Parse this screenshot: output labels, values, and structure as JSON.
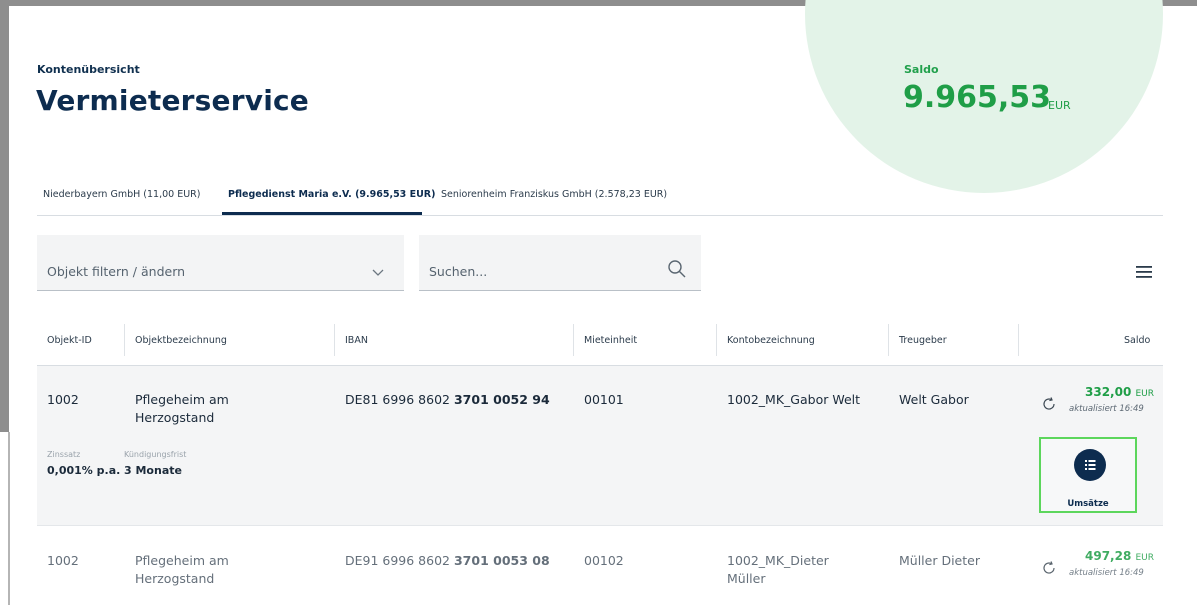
{
  "header": {
    "overline": "Kontenübersicht",
    "title": "Vermieterservice",
    "saldo_label": "Saldo",
    "saldo_value": "9.965,53",
    "saldo_unit": "EUR"
  },
  "tabs": [
    {
      "label": "Niederbayern GmbH (11,00 EUR)",
      "active": false
    },
    {
      "label": "Pflegedienst Maria e.V. (9.965,53 EUR)",
      "active": true
    },
    {
      "label": "Seniorenheim Franziskus GmbH (2.578,23 EUR)",
      "active": false
    }
  ],
  "filters": {
    "object_filter_label": "Objekt filtern / ändern",
    "search_placeholder": "Suchen..."
  },
  "table": {
    "columns": [
      "Objekt-ID",
      "Objektbezeichnung",
      "IBAN",
      "Mieteinheit",
      "Kontobezeichnung",
      "Treugeber",
      "Saldo"
    ],
    "rows": [
      {
        "objekt_id": "1002",
        "bezeichnung_line1": "Pflegeheim am",
        "bezeichnung_line2": "Herzogstand",
        "iban_prefix": "DE81 6996 8602 ",
        "iban_suffix": "3701 0052 94",
        "mieteinheit": "00101",
        "konto_line1": "1002_MK_Gabor Welt",
        "konto_line2": "",
        "treugeber": "Welt Gabor",
        "saldo_amount": "332,00",
        "saldo_unit": "EUR",
        "updated": "aktualisiert 16:49",
        "details": {
          "zinssatz_label": "Zinssatz",
          "zinssatz_value": "0,001% p.a.",
          "kuendigung_label": "Kündigungsfrist",
          "kuendigung_value": "3 Monate"
        },
        "action_label": "Umsätze"
      },
      {
        "objekt_id": "1002",
        "bezeichnung_line1": "Pflegeheim am",
        "bezeichnung_line2": "Herzogstand",
        "iban_prefix": "DE91 6996 8602 ",
        "iban_suffix": "3701 0053 08",
        "mieteinheit": "00102",
        "konto_line1": "1002_MK_Dieter",
        "konto_line2": "Müller",
        "treugeber": "Müller Dieter",
        "saldo_amount": "497,28",
        "saldo_unit": "EUR",
        "updated": "aktualisiert 16:49"
      }
    ]
  },
  "colors": {
    "navy": "#0d2c4f",
    "green": "#1f9e47",
    "circle": "#e3f3e8",
    "highlight": "#5cd65c"
  },
  "icons": [
    "chevron-down-icon",
    "search-icon",
    "hamburger-menu-icon",
    "refresh-icon",
    "list-icon"
  ]
}
